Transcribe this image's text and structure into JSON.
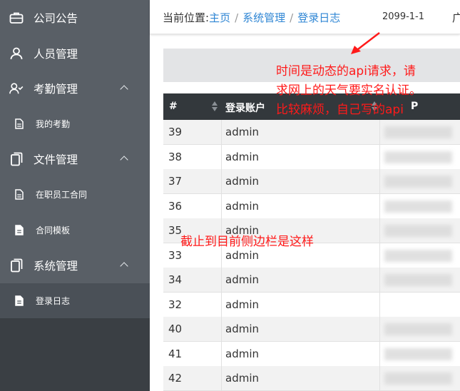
{
  "sidebar": {
    "items": [
      {
        "label": "公司公告",
        "icon": "briefcase-icon"
      },
      {
        "label": "人员管理",
        "icon": "user-icon"
      },
      {
        "label": "考勤管理",
        "icon": "user-check-icon"
      },
      {
        "label": "我的考勤",
        "icon": "document-icon"
      },
      {
        "label": "文件管理",
        "icon": "copy-icon"
      },
      {
        "label": "在职员工合同",
        "icon": "document-icon"
      },
      {
        "label": "合同模板",
        "icon": "document-icon"
      },
      {
        "label": "系统管理",
        "icon": "copy-icon"
      },
      {
        "label": "登录日志",
        "icon": "document-icon"
      }
    ]
  },
  "header": {
    "location_label": "当前位置:",
    "crumbs": [
      "主页",
      "系统管理",
      "登录日志"
    ],
    "date": "2099-1-1",
    "extra": "广"
  },
  "table": {
    "columns": [
      "#",
      "登录账户",
      "P"
    ],
    "rows": [
      {
        "id": "39",
        "account": "admin"
      },
      {
        "id": "38",
        "account": "admin"
      },
      {
        "id": "37",
        "account": "admin"
      },
      {
        "id": "36",
        "account": "admin"
      },
      {
        "id": "35",
        "account": "admin"
      },
      {
        "id": "33",
        "account": "admin"
      },
      {
        "id": "34",
        "account": "admin"
      },
      {
        "id": "32",
        "account": "admin"
      },
      {
        "id": "40",
        "account": "admin"
      },
      {
        "id": "41",
        "account": "admin"
      },
      {
        "id": "42",
        "account": "admin"
      }
    ]
  },
  "annotations": {
    "weather_note": [
      "时间是动态的api请求，请",
      "求网上的天气要实名认证。",
      "比较麻烦，自己写的api"
    ],
    "sidebar_note": "截止到目前侧边栏是这样"
  },
  "colors": {
    "sidebar_bg": "#595f66",
    "sidebar_bottom": "#3a3f44",
    "table_header": "#33383c",
    "link": "#2f86d4",
    "annotation": "#ff1a1a"
  }
}
